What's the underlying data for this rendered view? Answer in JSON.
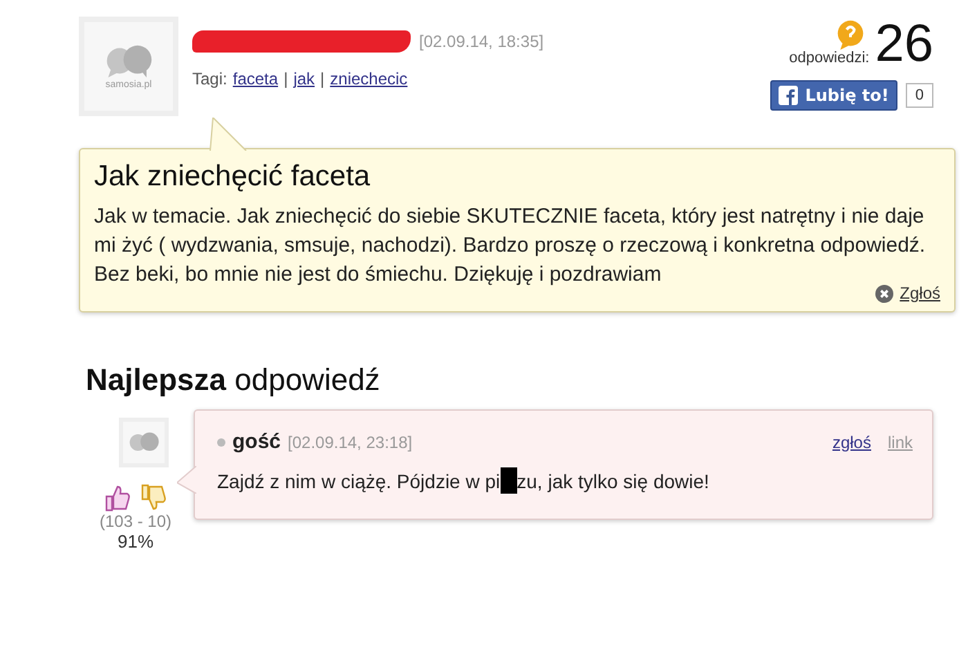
{
  "question": {
    "avatar_label": "samosia.pl",
    "author": {
      "redacted": true
    },
    "date": "[02.09.14, 18:35]",
    "tags_label": "Tagi:",
    "tags": [
      "faceta",
      "jak",
      "zniechecic"
    ],
    "tag_separator": "|",
    "answers_label": "odpowiedzi:",
    "answers_count": "26",
    "like_button": "Lubię to!",
    "like_count": "0",
    "title": "Jak zniechęcić faceta",
    "body": "Jak w temacie. Jak zniechęcić do siebie SKUTECZNIE faceta, który jest natrętny i nie daje mi żyć ( wydzwania, smsuje, nachodzi). Bardzo proszę o rzeczową i konkretna odpowiedź. Bez beki, bo mnie nie jest do śmiechu. Dziękuję i pozdrawiam",
    "report": "Zgłoś"
  },
  "best_answer": {
    "heading_bold": "Najlepsza",
    "heading_rest": "odpowiedź",
    "author": "gość",
    "date": "[02.09.14, 23:18]",
    "report": "zgłoś",
    "link": "link",
    "text_parts": [
      {
        "kind": "text",
        "text": "Zajdź z nim w ciążę. Pójdzie w pi"
      },
      {
        "kind": "redacted"
      },
      {
        "kind": "text",
        "text": "zu, jak tylko się dowie!"
      }
    ],
    "votes": "(103 - 10)",
    "percent": "91%"
  }
}
